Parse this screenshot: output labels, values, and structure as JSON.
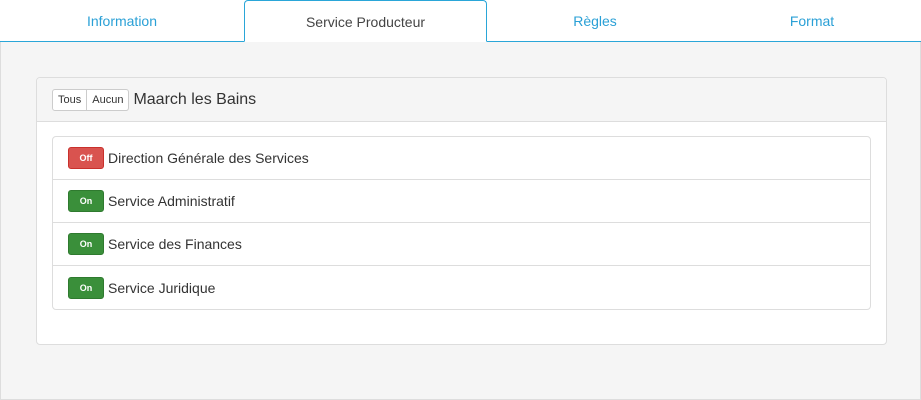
{
  "tabs": [
    {
      "label": "Information"
    },
    {
      "label": "Service Producteur"
    },
    {
      "label": "Règles"
    },
    {
      "label": "Format"
    }
  ],
  "panel": {
    "all_label": "Tous",
    "none_label": "Aucun",
    "title": "Maarch les Bains"
  },
  "services": [
    {
      "state": "Off",
      "label": "Direction Générale des Services"
    },
    {
      "state": "On",
      "label": "Service Administratif"
    },
    {
      "state": "On",
      "label": "Service des Finances"
    },
    {
      "state": "On",
      "label": "Service Juridique"
    }
  ],
  "colors": {
    "accent": "#2aa6d8",
    "on": "#3a8f3a",
    "off": "#d9534f"
  }
}
